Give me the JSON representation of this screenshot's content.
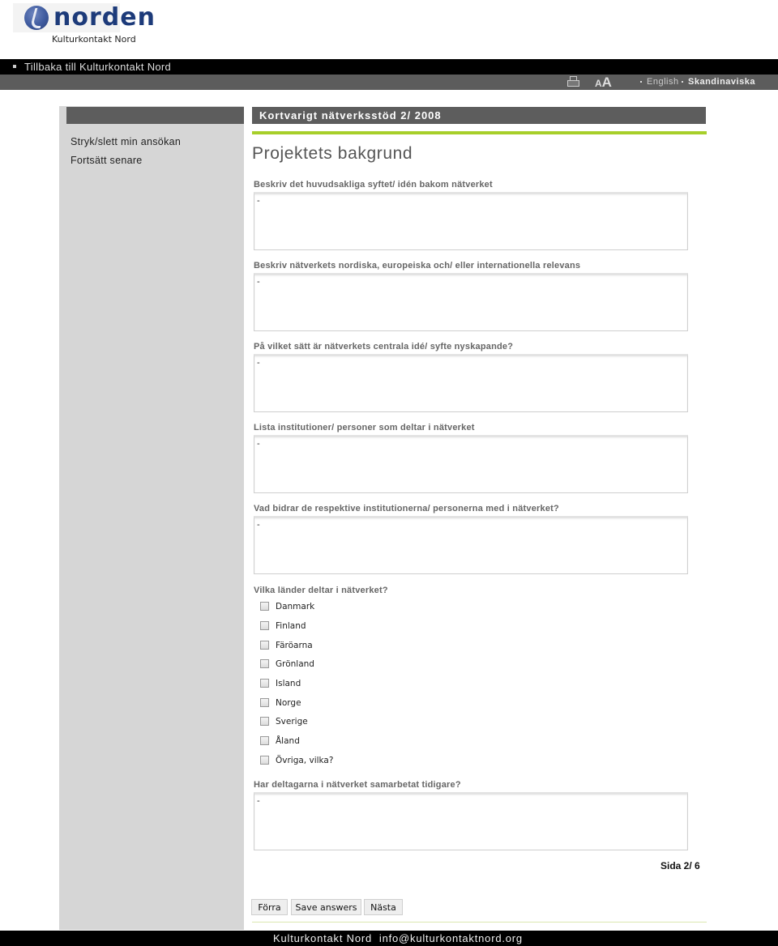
{
  "header": {
    "logo_word": "norden",
    "logo_subtitle": "Kulturkontakt Nord"
  },
  "topnav": {
    "back_link": "Tillbaka till Kulturkontakt Nord"
  },
  "toolbar": {
    "print_icon": "printer-icon",
    "fontsize_icon_small": "A",
    "fontsize_icon_large": "A",
    "languages": [
      {
        "label": "English",
        "active": false
      },
      {
        "label": "Skandinaviska",
        "active": true
      }
    ]
  },
  "sidebar": {
    "links": [
      {
        "label": "Stryk/slett min ansökan"
      },
      {
        "label": "Fortsätt senare"
      }
    ]
  },
  "form": {
    "header_title": "Kortvarigt nätverksstöd 2/ 2008",
    "section_title": "Projektets bakgrund",
    "questions": [
      {
        "label": "Beskriv det huvudsakliga syftet/ idén bakom nätverket",
        "value": "-"
      },
      {
        "label": "Beskriv nätverkets nordiska, europeiska och/ eller internationella relevans",
        "value": "-"
      },
      {
        "label": "På vilket sätt är nätverkets centrala idé/ syfte nyskapande?",
        "value": "-"
      },
      {
        "label": "Lista institutioner/ personer som deltar i nätverket",
        "value": "-"
      },
      {
        "label": "Vad bidrar de respektive institutionerna/ personerna med i nätverket?",
        "value": "-"
      }
    ],
    "countries_label": "Vilka länder deltar i nätverket?",
    "countries": [
      {
        "label": "Danmark",
        "checked": false
      },
      {
        "label": "Finland",
        "checked": false
      },
      {
        "label": "Färöarna",
        "checked": false
      },
      {
        "label": "Grönland",
        "checked": false
      },
      {
        "label": "Island",
        "checked": false
      },
      {
        "label": "Norge",
        "checked": false
      },
      {
        "label": "Sverige",
        "checked": false
      },
      {
        "label": "Åland",
        "checked": false
      },
      {
        "label": "Övriga, vilka?",
        "checked": false
      }
    ],
    "last_question": {
      "label": "Har deltagarna i nätverket samarbetat tidigare?",
      "value": "-"
    },
    "pager": "Sida 2/ 6",
    "buttons": {
      "prev": "Förra",
      "save": "Save answers",
      "next": "Nästa"
    }
  },
  "footer": {
    "text": "Kulturkontakt Nord  info@kulturkontaktnord.org"
  },
  "colors": {
    "accent": "#a7cf2a",
    "header_gray": "#5d5d5d",
    "sidebar_gray": "#d6d6d6",
    "nav_black": "#000000"
  }
}
